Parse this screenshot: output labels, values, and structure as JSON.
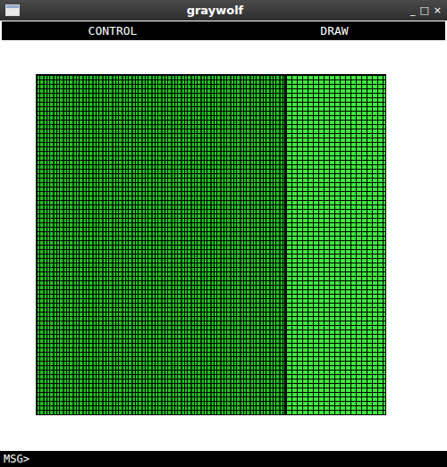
{
  "window": {
    "title": "graywolf",
    "controls": [
      "_",
      "□",
      "×"
    ]
  },
  "menu": [
    {
      "label": "CONTROL"
    },
    {
      "label": "DRAW"
    }
  ],
  "status_bar": {
    "prompt": "MSG>"
  }
}
